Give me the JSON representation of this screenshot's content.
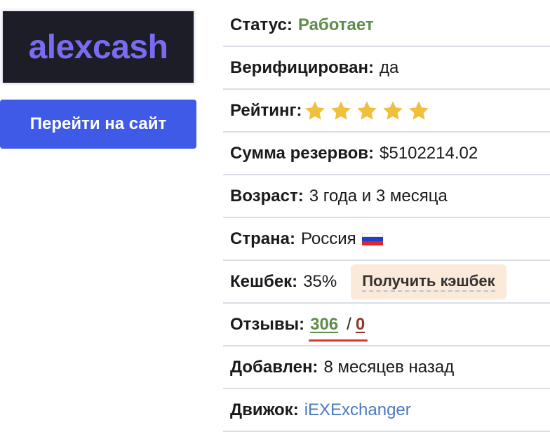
{
  "logo": {
    "text": "alexcash"
  },
  "site_button": {
    "label": "Перейти на сайт"
  },
  "info": {
    "status": {
      "label": "Статус:",
      "value": "Работает"
    },
    "verified": {
      "label": "Верифицирован:",
      "value": "да"
    },
    "rating": {
      "label": "Рейтинг:",
      "stars": 5,
      "max": 5
    },
    "reserves": {
      "label": "Сумма резервов:",
      "value": "$5102214.02"
    },
    "age": {
      "label": "Возраст:",
      "value": "3 года и 3 месяца"
    },
    "country": {
      "label": "Страна:",
      "value": "Россия",
      "flag_icon": "russia-flag-icon"
    },
    "cashback": {
      "label": "Кешбек:",
      "value": "35%",
      "button": "Получить кэшбек"
    },
    "reviews": {
      "label": "Отзывы:",
      "positive": "306",
      "separator": "/",
      "negative": "0"
    },
    "added": {
      "label": "Добавлен:",
      "value": "8 месяцев назад"
    },
    "engine": {
      "label": "Движок:",
      "value": "iEXExchanger"
    }
  },
  "colors": {
    "accent": "#3f5ae6",
    "green": "#5e8e4a",
    "link": "#4a79c2",
    "negative": "#8b3a2c",
    "star": "#f0bf3c"
  }
}
